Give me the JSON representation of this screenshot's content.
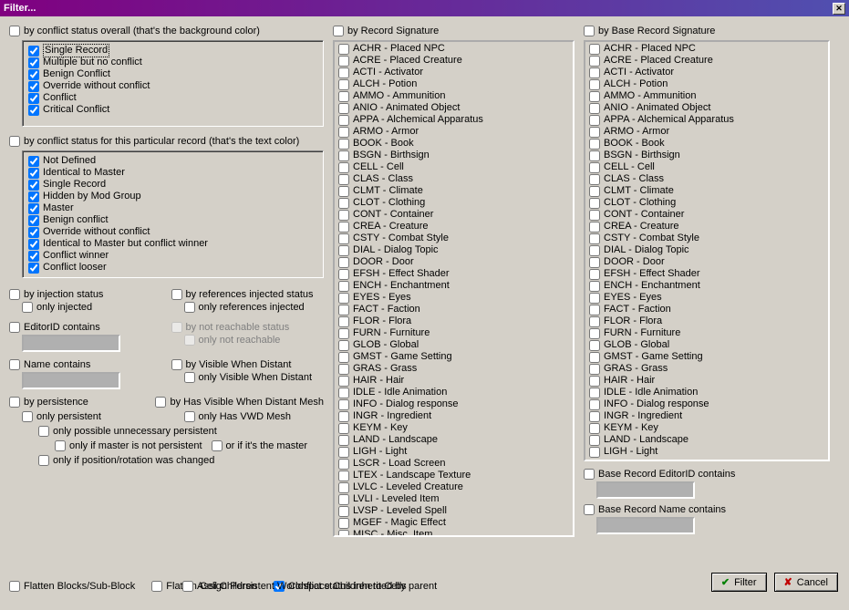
{
  "title": "Filter...",
  "col1": {
    "by_conflict_overall": "by conflict status overall (that's the background color)",
    "overall_items": [
      "Single Record",
      "Multiple but no conflict",
      "Benign Conflict",
      "Override without conflict",
      "Conflict",
      "Critical Conflict"
    ],
    "by_conflict_record": "by conflict status for this particular record  (that's the text color)",
    "record_items": [
      "Not Defined",
      "Identical to Master",
      "Single Record",
      "Hidden by Mod Group",
      "Master",
      "Benign conflict",
      "Override without conflict",
      "Identical to Master but conflict winner",
      "Conflict winner",
      "Conflict looser"
    ],
    "by_injection": "by injection status",
    "only_injected": "only injected",
    "by_refs_injected": "by references injected status",
    "only_refs_injected": "only references injected",
    "editorid_contains": "EditorID contains",
    "by_not_reachable": "by not reachable status",
    "only_not_reachable": "only not reachable",
    "name_contains": "Name contains",
    "by_vwd": "by Visible When Distant",
    "only_vwd": "only Visible When Distant",
    "by_persistence": "by persistence",
    "by_has_vwd_mesh": "by Has Visible When Distant Mesh",
    "only_persistent": "only persistent",
    "only_has_vwd_mesh": "only Has VWD Mesh",
    "only_unnec": "only possible unnecessary persistent",
    "only_if_master_not": "only if master is not persistent",
    "or_if_master": "or if it's the master",
    "only_if_pos": "only if position/rotation was changed",
    "flatten_blocks": "Flatten Blocks/Sub-Block",
    "flatten_cell": "Flatten Cell Children",
    "conflict_inherited": "Conflict status inherited by parent",
    "assign_persistent": "Assign Persistent Worldspace Children to Cells"
  },
  "col2": {
    "by_record_sig": "by Record Signature",
    "items": [
      "ACHR - Placed NPC",
      "ACRE - Placed Creature",
      "ACTI - Activator",
      "ALCH - Potion",
      "AMMO - Ammunition",
      "ANIO - Animated Object",
      "APPA - Alchemical Apparatus",
      "ARMO - Armor",
      "BOOK - Book",
      "BSGN - Birthsign",
      "CELL - Cell",
      "CLAS - Class",
      "CLMT - Climate",
      "CLOT - Clothing",
      "CONT - Container",
      "CREA - Creature",
      "CSTY - Combat Style",
      "DIAL - Dialog Topic",
      "DOOR - Door",
      "EFSH - Effect Shader",
      "ENCH - Enchantment",
      "EYES - Eyes",
      "FACT - Faction",
      "FLOR - Flora",
      "FURN - Furniture",
      "GLOB - Global",
      "GMST - Game Setting",
      "GRAS - Grass",
      "HAIR - Hair",
      "IDLE - Idle Animation",
      "INFO - Dialog response",
      "INGR - Ingredient",
      "KEYM - Key",
      "LAND - Landscape",
      "LIGH - Light",
      "LSCR - Load Screen",
      "LTEX - Landscape Texture",
      "LVLC - Leveled Creature",
      "LVLI - Leveled Item",
      "LVSP - Leveled Spell",
      "MGEF - Magic Effect",
      "MISC - Misc. Item"
    ]
  },
  "col3": {
    "by_base_sig": "by Base Record Signature",
    "items": [
      "ACHR - Placed NPC",
      "ACRE - Placed Creature",
      "ACTI - Activator",
      "ALCH - Potion",
      "AMMO - Ammunition",
      "ANIO - Animated Object",
      "APPA - Alchemical Apparatus",
      "ARMO - Armor",
      "BOOK - Book",
      "BSGN - Birthsign",
      "CELL - Cell",
      "CLAS - Class",
      "CLMT - Climate",
      "CLOT - Clothing",
      "CONT - Container",
      "CREA - Creature",
      "CSTY - Combat Style",
      "DIAL - Dialog Topic",
      "DOOR - Door",
      "EFSH - Effect Shader",
      "ENCH - Enchantment",
      "EYES - Eyes",
      "FACT - Faction",
      "FLOR - Flora",
      "FURN - Furniture",
      "GLOB - Global",
      "GMST - Game Setting",
      "GRAS - Grass",
      "HAIR - Hair",
      "IDLE - Idle Animation",
      "INFO - Dialog response",
      "INGR - Ingredient",
      "KEYM - Key",
      "LAND - Landscape",
      "LIGH - Light"
    ],
    "base_editorid": "Base Record EditorID contains",
    "base_name": "Base Record Name contains"
  },
  "buttons": {
    "filter": "Filter",
    "cancel": "Cancel"
  }
}
